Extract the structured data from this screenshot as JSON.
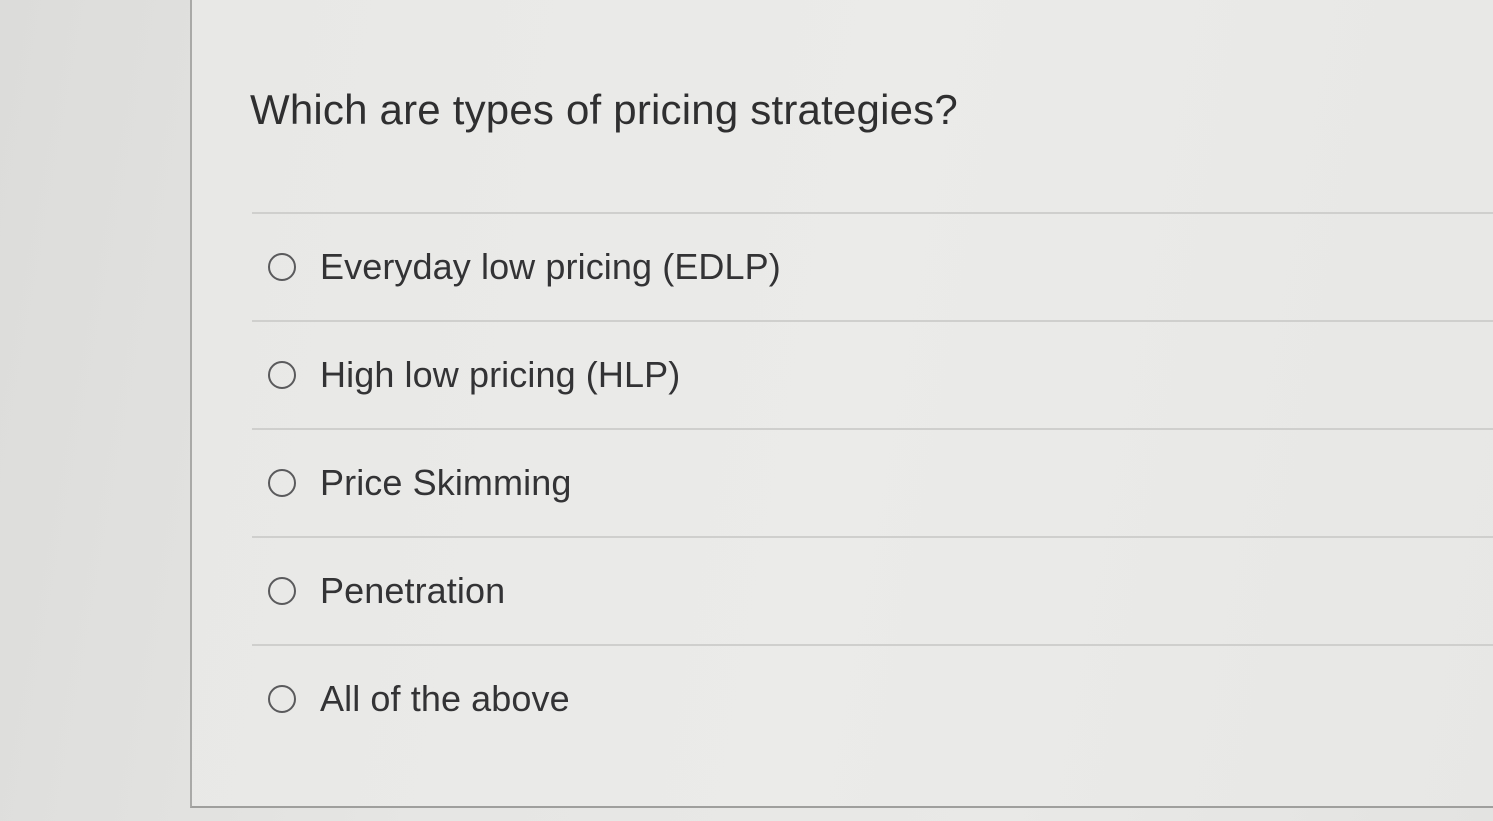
{
  "question": {
    "text": "Which are types of pricing strategies?"
  },
  "answers": [
    {
      "label": "Everyday low pricing (EDLP)",
      "selected": false
    },
    {
      "label": "High low pricing (HLP)",
      "selected": false
    },
    {
      "label": "Price Skimming",
      "selected": false
    },
    {
      "label": "Penetration",
      "selected": false
    },
    {
      "label": "All of the above",
      "selected": false
    }
  ]
}
